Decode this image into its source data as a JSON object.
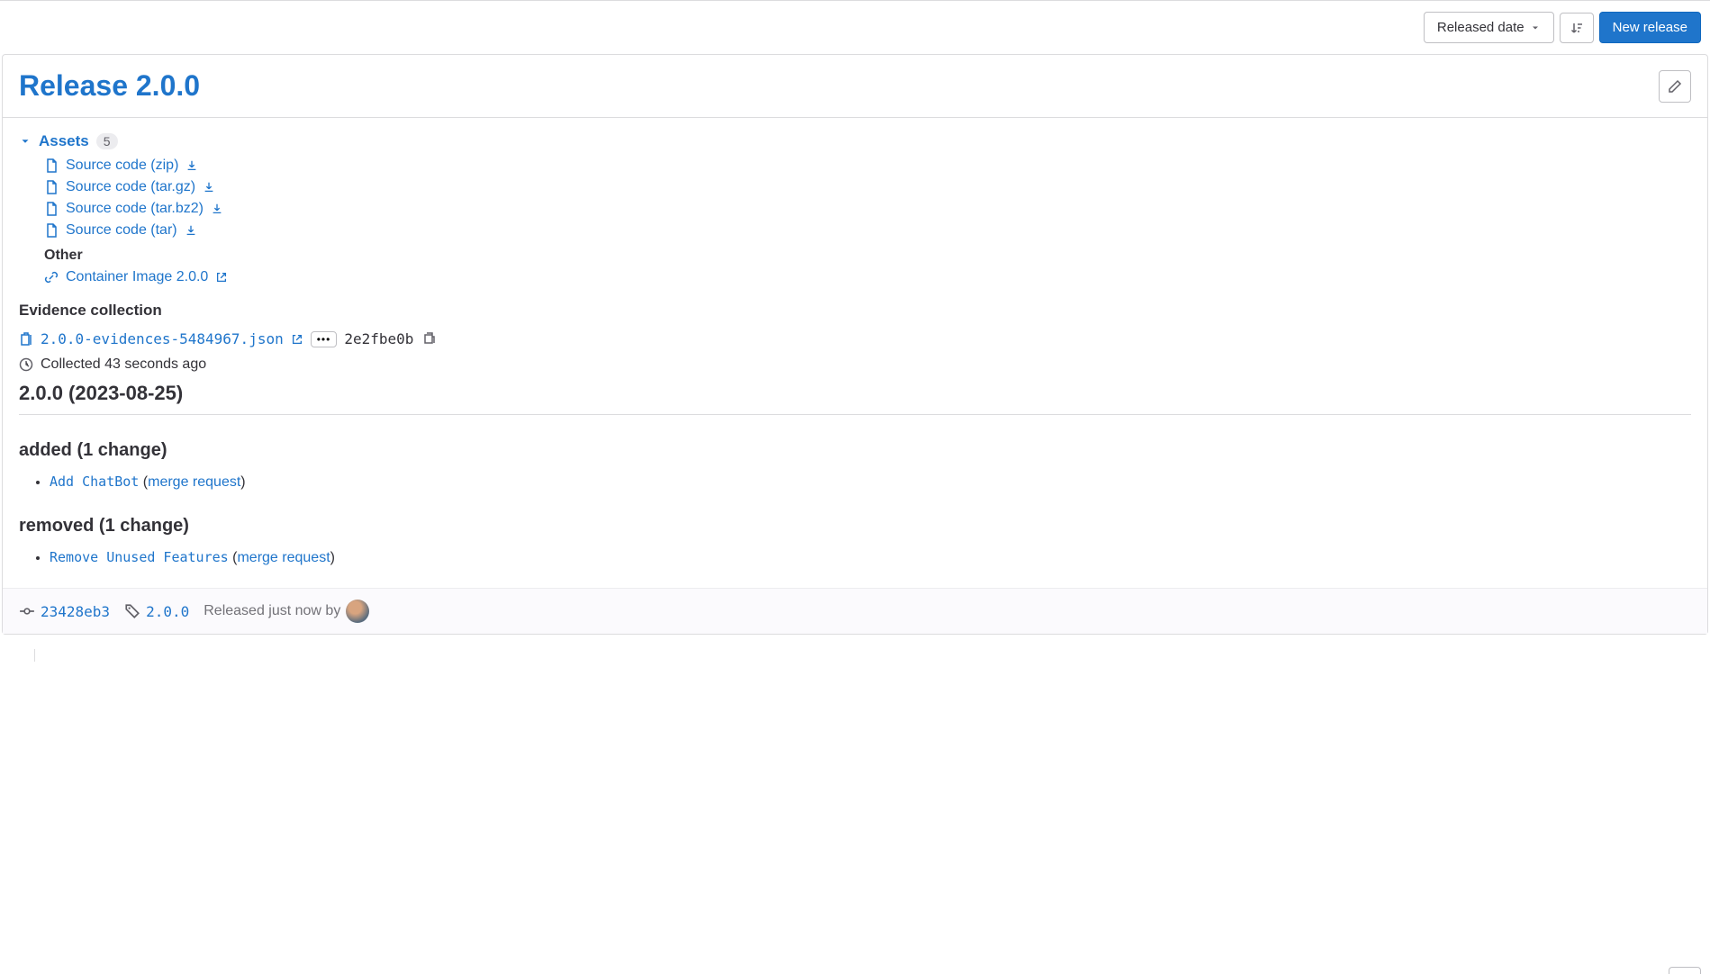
{
  "toolbar": {
    "sort_label": "Released date",
    "new_release_label": "New release"
  },
  "release": {
    "title": "Release 2.0.0",
    "assets_label": "Assets",
    "assets_count": "5",
    "source_assets": [
      {
        "label": "Source code (zip)"
      },
      {
        "label": "Source code (tar.gz)"
      },
      {
        "label": "Source code (tar.bz2)"
      },
      {
        "label": "Source code (tar)"
      }
    ],
    "other_label": "Other",
    "other_assets": [
      {
        "label": "Container Image 2.0.0"
      }
    ],
    "evidence_heading": "Evidence collection",
    "evidence_file": "2.0.0-evidences-5484967.json",
    "evidence_sha": "2e2fbe0b",
    "collected_text": "Collected 43 seconds ago",
    "notes": {
      "version_heading": "2.0.0 (2023-08-25)",
      "added_heading": "added (1 change)",
      "added_items": [
        {
          "code": "Add ChatBot",
          "link_text": "merge request"
        }
      ],
      "removed_heading": "removed (1 change)",
      "removed_items": [
        {
          "code": "Remove Unused Features",
          "link_text": "merge request"
        }
      ]
    },
    "footer": {
      "commit_sha": "23428eb3",
      "tag": "2.0.0",
      "released_by_text": "Released just now by"
    }
  }
}
